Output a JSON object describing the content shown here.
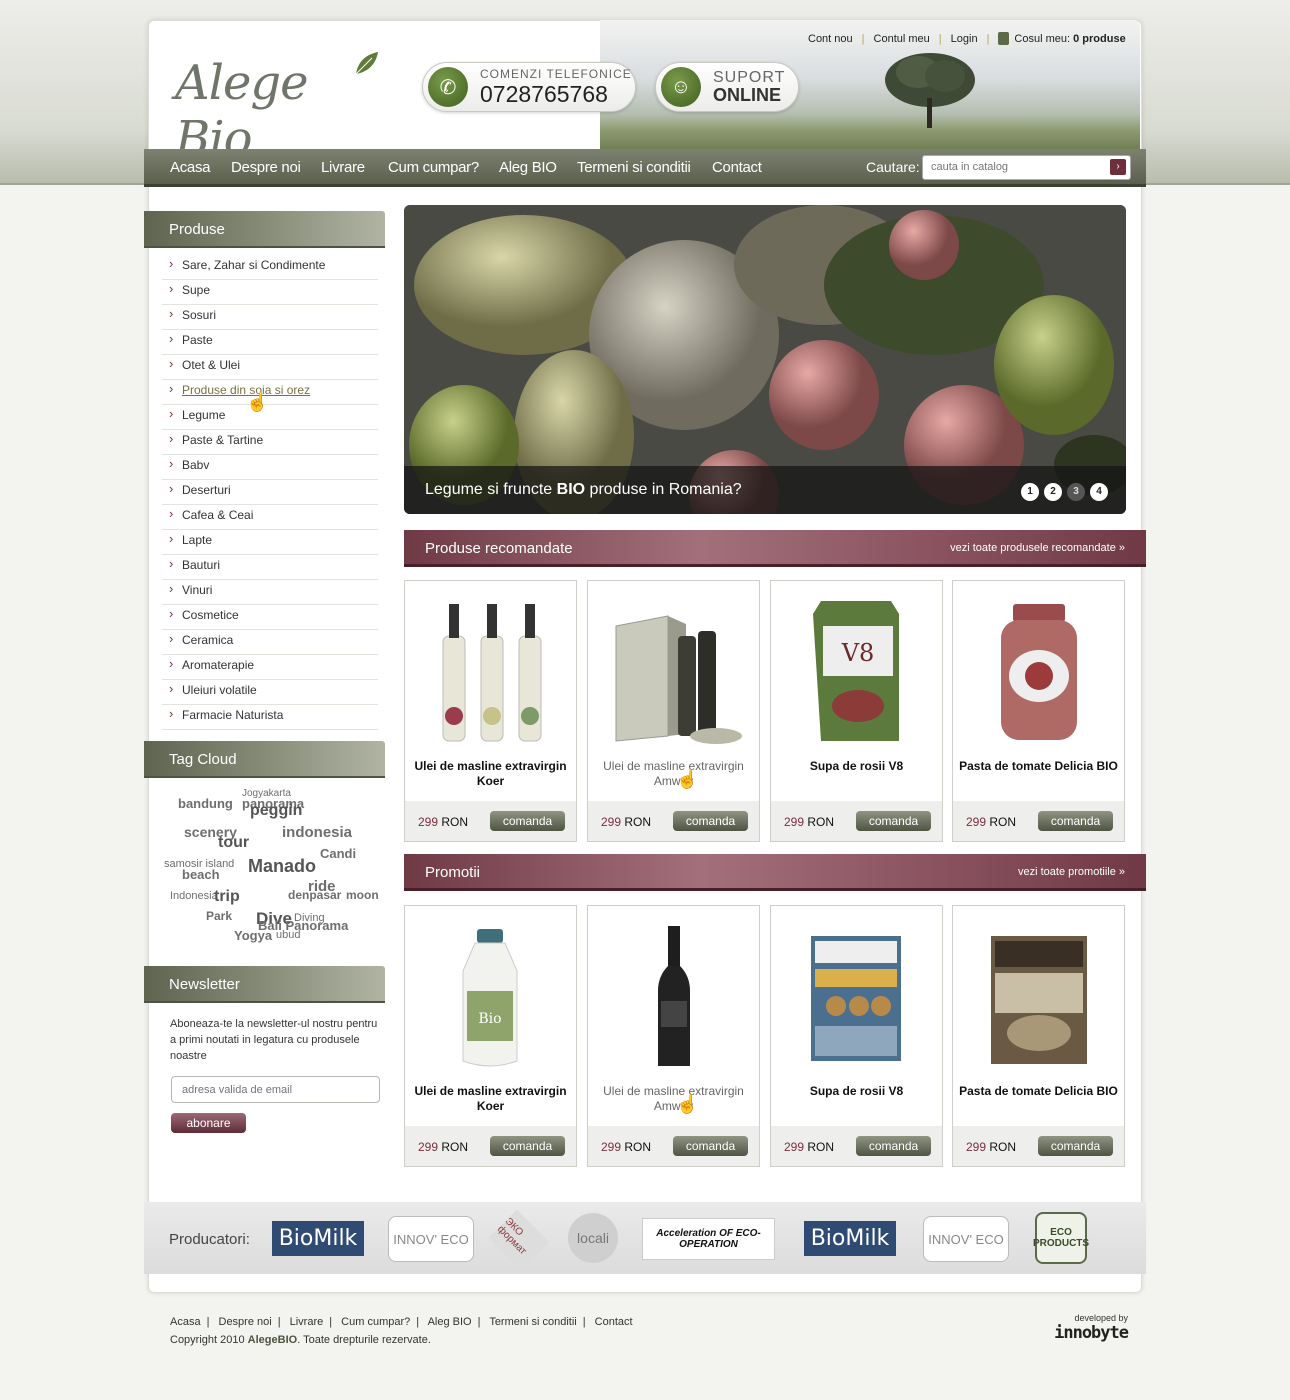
{
  "header": {
    "brand": "Alege Bio",
    "top_links": [
      "Cont nou",
      "Contul meu",
      "Login"
    ],
    "cart_label": "Cosul meu:",
    "cart_count": "0 produse",
    "phone_label": "COMENZI TELEFONICE",
    "phone_number": "0728765768",
    "support_label": "SUPORT",
    "support_status": "ONLINE"
  },
  "nav": {
    "items": [
      "Acasa",
      "Despre noi",
      "Livrare",
      "Cum cumpar?",
      "Aleg BIO",
      "Termeni si conditii",
      "Contact"
    ],
    "search_label": "Cautare:",
    "search_placeholder": "cauta in catalog"
  },
  "sidebar": {
    "products_title": "Produse",
    "categories": [
      "Sare, Zahar si Condimente",
      "Supe",
      "Sosuri",
      "Paste",
      "Otet & Ulei",
      "Produse din soia si orez",
      "Legume",
      "Paste & Tartine",
      "Babv",
      "Deserturi",
      "Cafea & Ceai",
      "Lapte",
      "Bauturi",
      "Vinuri",
      "Cosmetice",
      "Ceramica",
      "Aromaterapie",
      "Uleiuri volatile",
      "Farmacie Naturista"
    ],
    "active_category": "Produse din soia si orez",
    "tag_cloud_title": "Tag Cloud",
    "tags": [
      "bandung",
      "panorama",
      "Jogyakarta",
      "peggin",
      "scenery",
      "indonesia",
      "tour",
      "Candi",
      "Manado",
      "beach",
      "samosir island",
      "ride",
      "Indonesia",
      "trip",
      "denpasar",
      "moon",
      "Park",
      "Dive",
      "Bali Panorama",
      "Yogya",
      "ubud",
      "Diving"
    ],
    "newsletter_title": "Newsletter",
    "newsletter_text": "Aboneaza-te la newsletter-ul nostru pentru a primi noutati in legatura cu produsele noastre",
    "newsletter_placeholder": "adresa valida de email",
    "newsletter_button": "abonare"
  },
  "slider": {
    "caption_pre": "Legume si fruncte",
    "caption_bold": "BIO",
    "caption_post": "produse in Romania?",
    "pages": [
      "1",
      "2",
      "3",
      "4"
    ],
    "active_page": "3"
  },
  "recommended": {
    "title": "Produse recomandate",
    "link": "vezi toate produsele recomandate »",
    "products": [
      {
        "name": "Ulei de masline extravirgin Koer",
        "price": "299",
        "currency": "RON",
        "button": "comanda"
      },
      {
        "name": "Ulei de masline extravirgin Amway",
        "price": "299",
        "currency": "RON",
        "button": "comanda"
      },
      {
        "name": "Supa de rosii V8",
        "price": "299",
        "currency": "RON",
        "button": "comanda"
      },
      {
        "name": "Pasta de tomate Delicia BIO",
        "price": "299",
        "currency": "RON",
        "button": "comanda"
      }
    ]
  },
  "promotions": {
    "title": "Promotii",
    "link": "vezi toate promotiile »",
    "products": [
      {
        "name": "Ulei de masline extravirgin Koer",
        "price": "299",
        "currency": "RON",
        "button": "comanda"
      },
      {
        "name": "Ulei de masline extravirgin Amway",
        "price": "299",
        "currency": "RON",
        "button": "comanda"
      },
      {
        "name": "Supa de rosii V8",
        "price": "299",
        "currency": "RON",
        "button": "comanda"
      },
      {
        "name": "Pasta de tomate Delicia BIO",
        "price": "299",
        "currency": "RON",
        "button": "comanda"
      }
    ]
  },
  "manufacturers": {
    "label": "Producatori:",
    "logos": [
      "BioMilk",
      "INNOV' ECO",
      "ЭКО формат",
      "locali",
      "Acceleration OF ECO-OPERATION",
      "BioMilk",
      "INNOV' ECO",
      "ECO PRODUCTS"
    ]
  },
  "footer": {
    "links": [
      "Acasa",
      "Despre noi",
      "Livrare",
      "Cum cumpar?",
      "Aleg BIO",
      "Termeni si conditii",
      "Contact"
    ],
    "copyright_pre": "Copyright 2010",
    "copyright_brand": "AlegeBIO",
    "copyright_post": ". Toate drepturile rezervate.",
    "developed_by": "developed by",
    "developer": "innobyte"
  },
  "colors": {
    "olive": "#5a604c",
    "wine": "#7a2f3d"
  }
}
